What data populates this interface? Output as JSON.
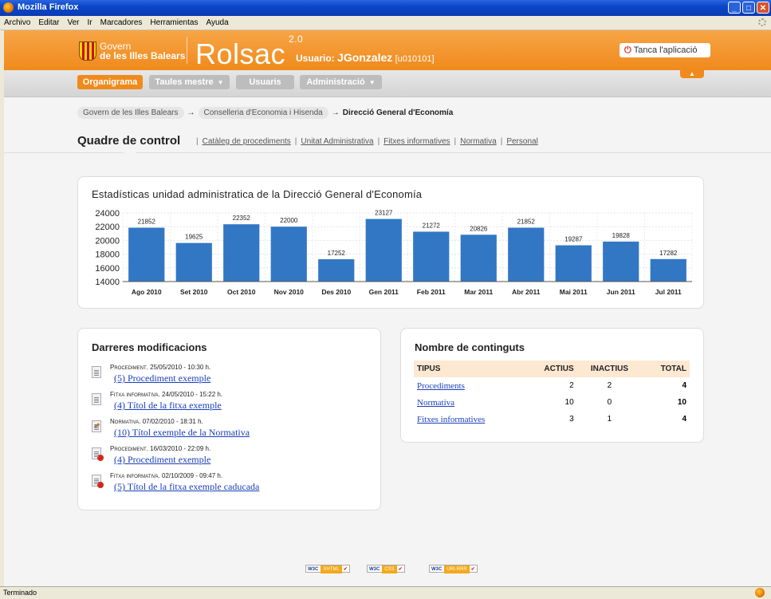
{
  "window": {
    "title": "Mozilla Firefox",
    "controls": {
      "minimize": "_",
      "maximize": "□",
      "close": "✕"
    }
  },
  "menubar": {
    "items": [
      "Archivo",
      "Editar",
      "Ver",
      "Ir",
      "Marcadores",
      "Herramientas",
      "Ayuda"
    ]
  },
  "header": {
    "gov_line1": "Govern",
    "gov_line2": "de les Illes Balears",
    "brand": "Rolsac",
    "version": "2.0",
    "user_label": "Usuario:",
    "user_name": "JGonzalez",
    "user_id": "[u010101]",
    "logout_label": "Tanca l'aplicació",
    "collapse_icon": "▲"
  },
  "nav": {
    "tabs": [
      {
        "label": "Organigrama",
        "caret": ""
      },
      {
        "label": "Taules mestre",
        "caret": "▼"
      },
      {
        "label": "Usuaris",
        "caret": ""
      },
      {
        "label": "Administració",
        "caret": "▼"
      }
    ]
  },
  "breadcrumb": {
    "items": [
      "Govern de les Illes Balears",
      "Conselleria d'Economia i Hisenda"
    ],
    "separator": "→",
    "current": "Direcció General d'Economía"
  },
  "page": {
    "title": "Quadre de control",
    "links": [
      "Catàleg de procediments",
      "Unitat Administrativa",
      "Fitxes informatives",
      "Normativa",
      "Personal"
    ],
    "link_separator": "|"
  },
  "stats": {
    "title": "Estadísticas unidad administratica de la Direcció General d'Economía"
  },
  "chart_data": {
    "type": "bar",
    "title": "Estadísticas unidad administratica de la Direcció General d'Economía",
    "categories": [
      "Ago 2010",
      "Set 2010",
      "Oct 2010",
      "Nov 2010",
      "Des 2010",
      "Gen 2011",
      "Feb 2011",
      "Mar 2011",
      "Abr 2011",
      "Mai 2011",
      "Jun 2011",
      "Jul 2011"
    ],
    "values": [
      21852,
      19625,
      22352,
      22000,
      17252,
      23127,
      21272,
      20826,
      21852,
      19287,
      19828,
      17282
    ],
    "yticks": [
      "24000",
      "22000",
      "20000",
      "18000",
      "16000",
      "14000"
    ],
    "ylim": [
      14000,
      24000
    ],
    "bar_color": "#3277c4",
    "grid": true,
    "xlabel": "",
    "ylabel": ""
  },
  "mods": {
    "title": "Darreres modificacions",
    "items": [
      {
        "kind": "Procediment.",
        "date": "25/05/2010 - 10:30 h.",
        "link": "(5) Procediment exemple",
        "icon": "document-icon"
      },
      {
        "kind": "Fitxa informativa.",
        "date": "24/05/2010 - 15:22 h.",
        "link": "(4) Títol de la fitxa exemple",
        "icon": "document-icon"
      },
      {
        "kind": "Normativa.",
        "date": "07/02/2010 - 18:31 h.",
        "link": "(10) Títol exemple de la Normativa",
        "icon": "edit-document-icon"
      },
      {
        "kind": "Procediment.",
        "date": "16/03/2010 - 22:09 h.",
        "link": "(4) Procediment exemple",
        "icon": "expired-document-icon"
      },
      {
        "kind": "Fitxa informativa.",
        "date": "02/10/2009 - 09:47 h.",
        "link": "(5) Títol de la fitxa exemple caducada",
        "icon": "expired-document-icon"
      }
    ]
  },
  "counts": {
    "title": "Nombre de continguts",
    "headers": [
      "TIPUS",
      "ACTIUS",
      "INACTIUS",
      "TOTAL"
    ],
    "rows": [
      {
        "tipus": "Procediments",
        "actius": "2",
        "inactius": "2",
        "total": "4"
      },
      {
        "tipus": "Normativa",
        "actius": "10",
        "inactius": "0",
        "total": "10"
      },
      {
        "tipus": "Fitxes informatives",
        "actius": "3",
        "inactius": "1",
        "total": "4"
      }
    ]
  },
  "footer": {
    "badges": [
      {
        "w3c": "W3C",
        "label": "XHTML",
        "check": "✔"
      },
      {
        "w3c": "W3C",
        "label": "CSS",
        "check": "✔"
      },
      {
        "w3c": "W3C",
        "label": "URI-RRR",
        "check": "✔"
      }
    ]
  },
  "status": {
    "text": "Terminado"
  }
}
